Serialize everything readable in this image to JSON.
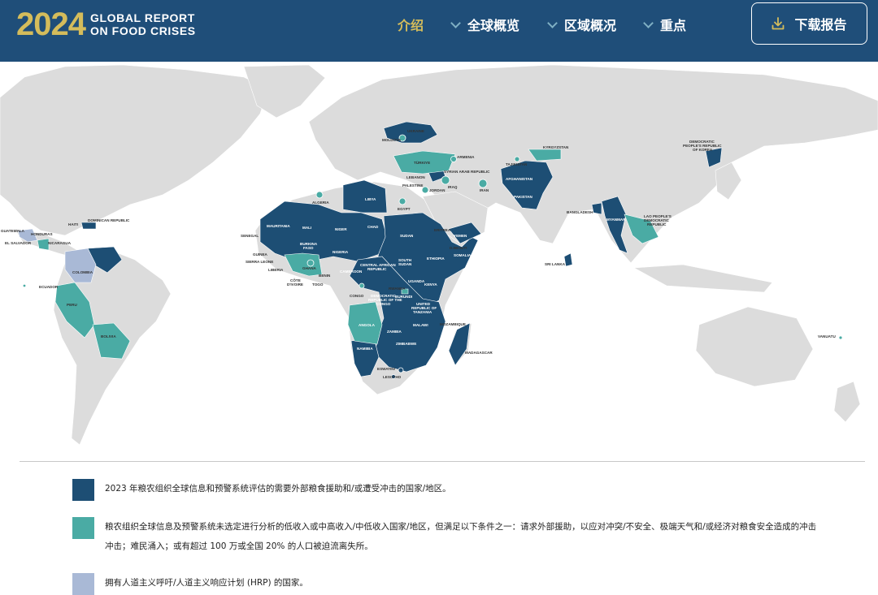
{
  "header": {
    "logo_year": "2024",
    "logo_line1": "GLOBAL REPORT",
    "logo_line2": "ON FOOD CRISES",
    "nav": [
      {
        "label": "介绍",
        "active": true
      },
      {
        "label": "全球概览",
        "dropdown": true
      },
      {
        "label": "区域概况",
        "dropdown": true
      },
      {
        "label": "重点",
        "dropdown": true
      }
    ],
    "download_label": "下载报告"
  },
  "colors": {
    "header_bg": "#1f4e79",
    "accent_gold": "#d4bc5b",
    "dark_navy": "#1d4e74",
    "teal": "#4aaba4",
    "light_blue": "#a9b9d6",
    "land_grey": "#dcdcdc",
    "ocean": "#ffffff"
  },
  "map": {
    "labels": {
      "ukraine": "UKRAINE",
      "moldova": "MOLDOVA",
      "armenia": "ARMENIA",
      "turkiye": "TÜRKIYE",
      "syria": "SYRIAN ARAB REPUBLIC",
      "lebanon": "LEBANON",
      "palestine": "PALESTINE",
      "jordan": "JORDAN",
      "iraq": "IRAQ",
      "iran": "IRAN",
      "kyrgyzstan": "KYRGYZSTAN",
      "tajikistan": "TAJIKISTAN",
      "afghanistan": "AFGHANISTAN",
      "pakistan": "PAKISTAN",
      "dprk1": "DEMOCRATIC",
      "dprk2": "PEOPLE'S REPUBLIC",
      "dprk3": "OF KOREA",
      "bangladesh": "BANGLADESH",
      "myanmar": "MYANMAR",
      "lao1": "LAO PEOPLE'S",
      "lao2": "DEMOCRATIC",
      "lao3": "REPUBLIC",
      "srilanka": "SRI LANKA",
      "algeria": "ALGERIA",
      "libya": "LIBYA",
      "egypt": "EGYPT",
      "mauritania": "MAURITANIA",
      "mali": "MALI",
      "niger": "NIGER",
      "chad": "CHAD",
      "sudan": "SUDAN",
      "eritrea": "ERITREA",
      "yemen": "YEMEN",
      "djibouti": "DJIBOUTI",
      "somalia": "SOMALIA",
      "ethiopia": "ETHIOPIA",
      "senegal": "SENEGAL",
      "guinea": "GUINEA",
      "sierraleone": "SIERRA LEONE",
      "liberia": "LIBERIA",
      "burkina1": "BURKINA",
      "burkina2": "FASO",
      "nigeria": "NIGERIA",
      "cote1": "CÔTE",
      "cote2": "D'IVOIRE",
      "ghana": "GHANA",
      "togo": "TOGO",
      "benin": "BENIN",
      "cameroon": "CAMEROON",
      "car1": "CENTRAL AFRICAN",
      "car2": "REPUBLIC",
      "southsudan1": "SOUTH",
      "southsudan2": "SUDAN",
      "uganda": "UGANDA",
      "kenya": "KENYA",
      "rwanda": "RWANDA",
      "burundi": "BURUNDI",
      "congo": "CONGO",
      "drc1": "DEMOCRATIC",
      "drc2": "REPUBLIC OF THE",
      "drc3": "CONGO",
      "tanzania1": "UNITED",
      "tanzania2": "REPUBLIC OF",
      "tanzania3": "TANZANIA",
      "angola": "ANGOLA",
      "zambia": "ZAMBIA",
      "malawi": "MALAWI",
      "mozambique": "MOZAMBIQUE",
      "zimbabwe": "ZIMBABWE",
      "namibia": "NAMIBIA",
      "madagascar": "MADAGASCAR",
      "eswatini": "ESWATINI",
      "lesotho": "LESOTHO",
      "haiti": "HAITI",
      "dominican": "DOMINICAN REPUBLIC",
      "guatemala": "GUATEMALA",
      "honduras": "HONDURAS",
      "elsalvador": "EL SALVADOR",
      "nicaragua": "NICARAGUA",
      "colombia": "COLOMBIA",
      "ecuador": "ECUADOR",
      "peru": "PERU",
      "bolivia": "BOLIVIA",
      "vanuatu": "VANUATU"
    }
  },
  "legend": [
    {
      "color": "#1d4e74",
      "text": "2023 年粮农组织全球信息和预警系统评估的需要外部粮食援助和/或遭受冲击的国家/地区。"
    },
    {
      "color": "#4aaba4",
      "text": "粮农组织全球信息及预警系统未选定进行分析的低收入或中高收入/中低收入国家/地区，但满足以下条件之一：请求外部援助，以应对冲突/不安全、极端天气和/或经济对粮食安全造成的冲击冲击；难民涌入；或有超过 100 万或全国 20% 的人口被迫流离失所。"
    },
    {
      "color": "#a9b9d6",
      "text": "拥有人道主义呼吁/人道主义响应计划 (HRP) 的国家。"
    }
  ]
}
